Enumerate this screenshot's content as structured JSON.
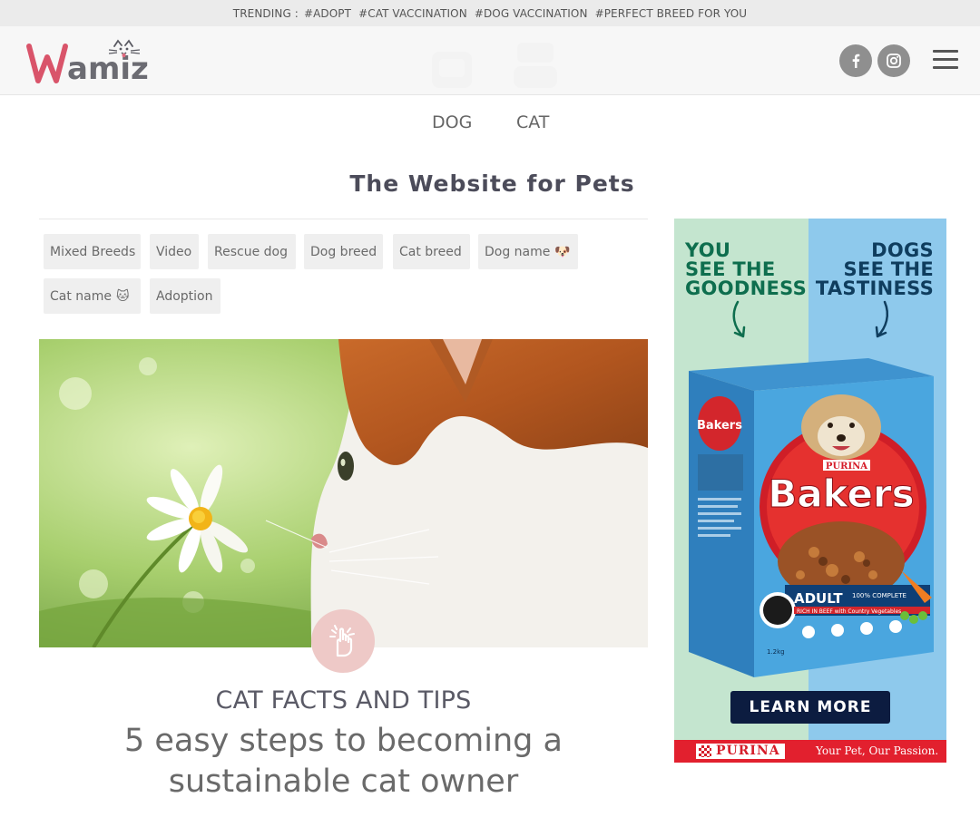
{
  "trending": {
    "label": "TRENDING :",
    "items": [
      "#ADOPT",
      "#CAT VACCINATION",
      "#DOG VACCINATION",
      "#PERFECT BREED FOR YOU"
    ]
  },
  "header": {
    "logo_text": "Wamiz",
    "social": [
      "facebook-icon",
      "instagram-icon"
    ]
  },
  "nav": {
    "items": [
      "DOG",
      "CAT"
    ]
  },
  "site_title": "The Website for Pets",
  "tags": [
    {
      "label": "Mixed Breeds",
      "emoji": ""
    },
    {
      "label": "Video",
      "emoji": ""
    },
    {
      "label": "Rescue dog",
      "emoji": ""
    },
    {
      "label": "Dog breed",
      "emoji": ""
    },
    {
      "label": "Cat breed",
      "emoji": ""
    },
    {
      "label": "Dog name",
      "emoji": "🐶"
    },
    {
      "label": "Cat name",
      "emoji": "🐱"
    },
    {
      "label": "Adoption",
      "emoji": ""
    }
  ],
  "article": {
    "category": "CAT FACTS AND TIPS",
    "headline": "5 easy steps to becoming a sustainable cat owner",
    "badge_icon": "hand-point-icon"
  },
  "ad": {
    "left_headline": [
      "YOU",
      "SEE THE",
      "GOODNESS"
    ],
    "right_headline": [
      "DOGS",
      "SEE THE",
      "TASTINESS"
    ],
    "brand": "Bakers",
    "maker": "PURINA",
    "product_variant": "ADULT",
    "product_badge": "100% COMPLETE",
    "product_sub": "RICH IN BEEF with Country Vegetables",
    "weight": "1.2kg",
    "cta": "LEARN MORE",
    "footer_brand": "PURINA",
    "footer_tagline": "Your Pet, Our Passion."
  },
  "colors": {
    "logo": "#d9546a",
    "badge": "#eec9c7",
    "ad_left": "#c4e5cf",
    "ad_right": "#8ec9ec",
    "ad_footer": "#e2202e",
    "cta_bg": "#0c1c40"
  }
}
